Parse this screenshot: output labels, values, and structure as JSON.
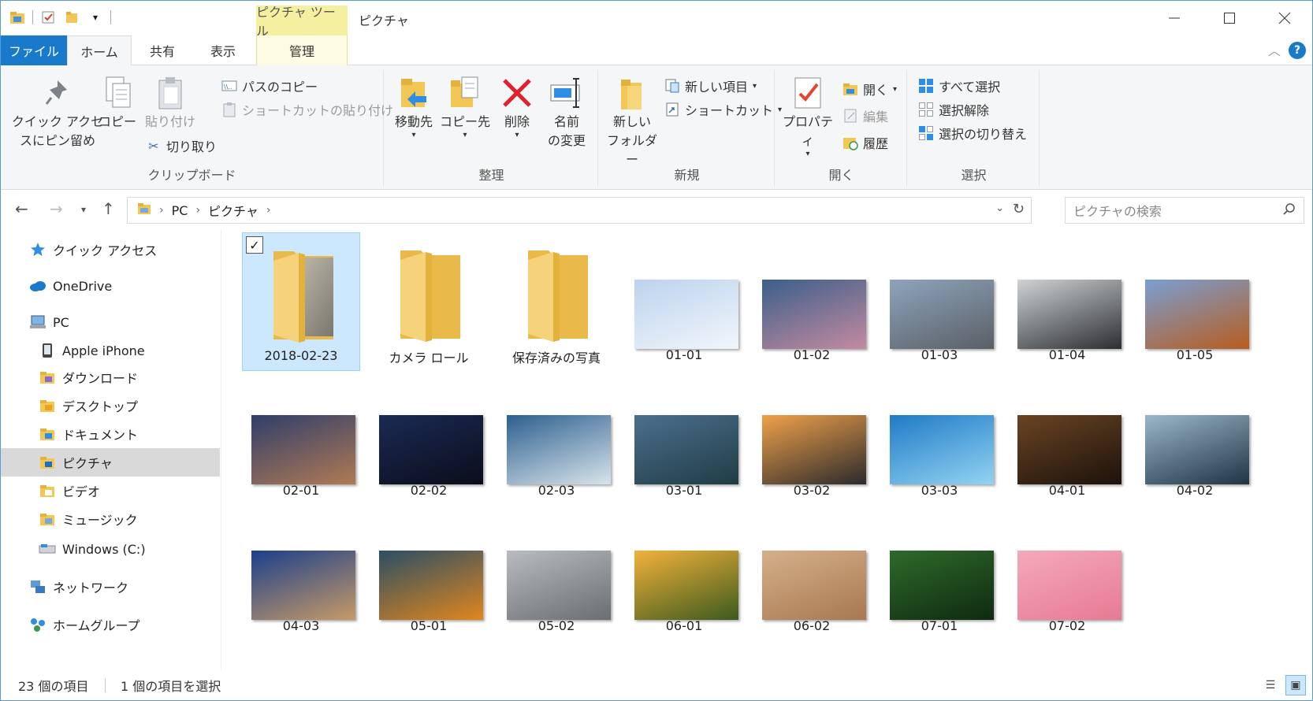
{
  "title_bar": {
    "context_tab": "ピクチャ ツール",
    "title": "ピクチャ"
  },
  "tabs": {
    "file": "ファイル",
    "home": "ホーム",
    "share": "共有",
    "view": "表示",
    "manage": "管理"
  },
  "ribbon": {
    "clipboard": {
      "label": "クリップボード",
      "pin_line1": "クイック アクセ",
      "pin_line2": "スにピン留め",
      "copy": "コピー",
      "paste": "貼り付け",
      "copy_path": "パスのコピー",
      "paste_shortcut": "ショートカットの貼り付け",
      "cut": "切り取り"
    },
    "organize": {
      "label": "整理",
      "move_to": "移動先",
      "copy_to": "コピー先",
      "delete": "削除",
      "rename_line1": "名前",
      "rename_line2": "の変更"
    },
    "new": {
      "label": "新規",
      "new_folder_line1": "新しい",
      "new_folder_line2": "フォルダー",
      "new_item": "新しい項目",
      "shortcut": "ショートカット"
    },
    "open": {
      "label": "開く",
      "properties": "プロパティ",
      "open": "開く",
      "edit": "編集",
      "history": "履歴"
    },
    "select": {
      "label": "選択",
      "select_all": "すべて選択",
      "select_none": "選択解除",
      "invert": "選択の切り替え"
    }
  },
  "address": {
    "crumbs": [
      "PC",
      "ピクチャ"
    ],
    "search_placeholder": "ピクチャの検索"
  },
  "sidebar": {
    "items": [
      {
        "label": "クイック アクセス",
        "icon": "star-icon"
      },
      {
        "label": "OneDrive",
        "icon": "cloud-icon"
      },
      {
        "label": "PC",
        "icon": "computer-icon"
      },
      {
        "label": "Apple iPhone",
        "icon": "phone-icon"
      },
      {
        "label": "ダウンロード",
        "icon": "download-folder-icon"
      },
      {
        "label": "デスクトップ",
        "icon": "desktop-folder-icon"
      },
      {
        "label": "ドキュメント",
        "icon": "documents-folder-icon"
      },
      {
        "label": "ピクチャ",
        "icon": "pictures-folder-icon"
      },
      {
        "label": "ビデオ",
        "icon": "videos-folder-icon"
      },
      {
        "label": "ミュージック",
        "icon": "music-folder-icon"
      },
      {
        "label": "Windows (C:)",
        "icon": "drive-icon"
      },
      {
        "label": "ネットワーク",
        "icon": "network-icon"
      },
      {
        "label": "ホームグループ",
        "icon": "homegroup-icon"
      }
    ]
  },
  "files": [
    {
      "name": "2018-02-23",
      "kind": "folder",
      "colors": [
        "#c9c3b4",
        "#7a776e"
      ]
    },
    {
      "name": "カメラ ロール",
      "kind": "folder"
    },
    {
      "name": "保存済みの写真",
      "kind": "folder"
    },
    {
      "name": "01-01",
      "kind": "image",
      "colors": [
        "#bcd3ee",
        "#f2f6fb"
      ]
    },
    {
      "name": "01-02",
      "kind": "image",
      "colors": [
        "#3b5f8a",
        "#c48aa0"
      ]
    },
    {
      "name": "01-03",
      "kind": "image",
      "colors": [
        "#8ea4bc",
        "#5a5f66"
      ]
    },
    {
      "name": "01-04",
      "kind": "image",
      "colors": [
        "#cfd3d6",
        "#2c2e31"
      ]
    },
    {
      "name": "01-05",
      "kind": "image",
      "colors": [
        "#7a9fd3",
        "#b85c1e"
      ]
    },
    {
      "name": "02-01",
      "kind": "image",
      "colors": [
        "#2f3e6b",
        "#b07a54"
      ]
    },
    {
      "name": "02-02",
      "kind": "image",
      "colors": [
        "#1b2a55",
        "#0a0d1a"
      ]
    },
    {
      "name": "02-03",
      "kind": "image",
      "colors": [
        "#2d5f8f",
        "#d8e4ea"
      ]
    },
    {
      "name": "03-01",
      "kind": "image",
      "colors": [
        "#4d6f8f",
        "#1f3c44"
      ]
    },
    {
      "name": "03-02",
      "kind": "image",
      "colors": [
        "#f0a14a",
        "#2b2a2c"
      ]
    },
    {
      "name": "03-03",
      "kind": "image",
      "colors": [
        "#1f7bc6",
        "#93d3f2"
      ]
    },
    {
      "name": "04-01",
      "kind": "image",
      "colors": [
        "#6a4423",
        "#1c120b"
      ]
    },
    {
      "name": "04-02",
      "kind": "image",
      "colors": [
        "#9ab7c9",
        "#1f3445"
      ]
    },
    {
      "name": "04-03",
      "kind": "image",
      "colors": [
        "#1b3f8c",
        "#c79a66"
      ]
    },
    {
      "name": "05-01",
      "kind": "image",
      "colors": [
        "#2a4e66",
        "#e1861d"
      ]
    },
    {
      "name": "05-02",
      "kind": "image",
      "colors": [
        "#b8bcc0",
        "#6a6e72"
      ]
    },
    {
      "name": "06-01",
      "kind": "image",
      "colors": [
        "#f3b23a",
        "#3c5a1e"
      ]
    },
    {
      "name": "06-02",
      "kind": "image",
      "colors": [
        "#d4b08a",
        "#a87850"
      ]
    },
    {
      "name": "07-01",
      "kind": "image",
      "colors": [
        "#2e6a2a",
        "#0f2a10"
      ]
    },
    {
      "name": "07-02",
      "kind": "image",
      "colors": [
        "#f4a9bb",
        "#e77a93"
      ]
    }
  ],
  "status": {
    "count": "23 個の項目",
    "selected": "1 個の項目を選択"
  },
  "colors": {
    "accent": "#1979ca",
    "selection": "#cce8ff",
    "context_tab": "#f4f0a0"
  }
}
